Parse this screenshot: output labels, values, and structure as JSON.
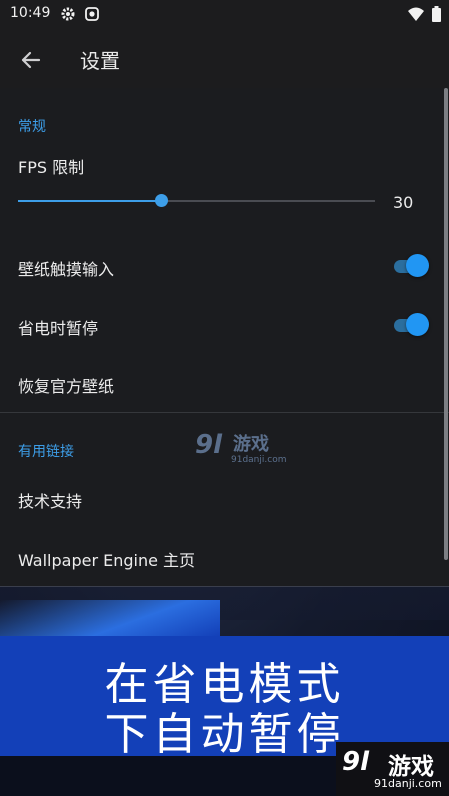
{
  "status_bar": {
    "time": "10:49",
    "icons_left": [
      "gear-icon",
      "screen-record-icon"
    ],
    "icons_right": [
      "wifi-icon",
      "battery-icon"
    ]
  },
  "app_bar": {
    "title": "设置",
    "back_icon": "arrow-left-icon"
  },
  "sections": {
    "general": {
      "label": "常规",
      "fps_limit": {
        "label": "FPS 限制",
        "value": "30",
        "slider_fraction": 0.4
      },
      "wallpaper_touch": {
        "label": "壁纸触摸输入",
        "enabled": true
      },
      "power_save_pause": {
        "label": "省电时暂停",
        "enabled": true
      },
      "restore_wallpapers": {
        "label": "恢复官方壁纸"
      }
    },
    "links": {
      "label": "有用链接",
      "support": {
        "label": "技术支持"
      },
      "homepage": {
        "label": "Wallpaper Engine 主页"
      }
    }
  },
  "banner": {
    "line1": "在省电模式",
    "line2": "下自动暂停"
  },
  "watermark": {
    "mark": "9l",
    "text": "游戏",
    "url": "91danji.com"
  },
  "colors": {
    "accent": "#3d9ee8",
    "toggle_on": "#2196f3",
    "banner": "#1340b8",
    "background": "#1b1c1f"
  }
}
